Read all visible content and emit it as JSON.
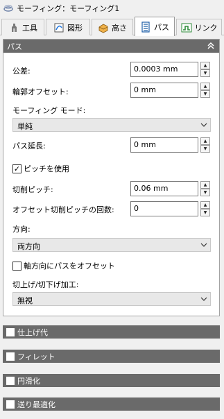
{
  "window": {
    "title": "モーフィング：モーフィング1"
  },
  "tabs": [
    {
      "label": "工具",
      "icon": "tool-icon"
    },
    {
      "label": "図形",
      "icon": "shape-icon"
    },
    {
      "label": "高さ",
      "icon": "height-icon"
    },
    {
      "label": "パス",
      "icon": "path-icon",
      "active": true
    },
    {
      "label": "リンク",
      "icon": "link-icon"
    }
  ],
  "path_section": {
    "title": "パス",
    "tolerance": {
      "label": "公差:",
      "value": "0.0003 mm"
    },
    "contour_offset": {
      "label": "輪郭オフセット:",
      "value": "0 mm"
    },
    "morphing_mode": {
      "label": "モーフィング モード:",
      "value": "単純"
    },
    "path_extension": {
      "label": "パス延長:",
      "value": "0 mm"
    },
    "use_stepover": {
      "label": "ピッチを使用",
      "checked": true
    },
    "stepover": {
      "label": "切削ピッチ:",
      "value": "0.06 mm"
    },
    "offset_stepover_count": {
      "label": "オフセット切削ピッチの回数:",
      "value": "0"
    },
    "direction": {
      "label": "方向:",
      "value": "両方向"
    },
    "offset_axial": {
      "label": "軸方向にパスをオフセット",
      "checked": false
    },
    "up_down_milling": {
      "label": "切上げ/切下げ加工:",
      "value": "無視"
    }
  },
  "collapsed_sections": [
    {
      "label": "仕上げ代"
    },
    {
      "label": "フィレット"
    },
    {
      "label": "円滑化"
    },
    {
      "label": "送り最適化"
    }
  ]
}
